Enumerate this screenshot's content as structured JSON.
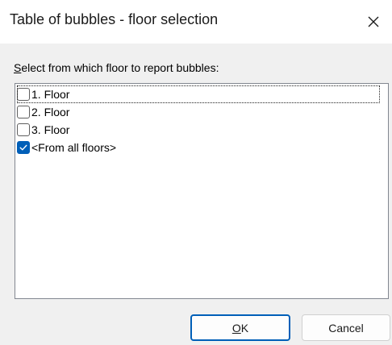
{
  "dialog": {
    "title": "Table of bubbles - floor selection",
    "close_icon": "close-icon"
  },
  "prompt": {
    "mnemonic": "S",
    "rest": "elect from which floor to report bubbles:"
  },
  "floors": {
    "items": [
      {
        "label": "1. Floor",
        "checked": false,
        "focused": true
      },
      {
        "label": "2. Floor",
        "checked": false,
        "focused": false
      },
      {
        "label": "3. Floor",
        "checked": false,
        "focused": false
      },
      {
        "label": "<From all floors>",
        "checked": true,
        "focused": false
      }
    ]
  },
  "buttons": {
    "ok_mnemonic": "O",
    "ok_rest": "K",
    "cancel": "Cancel"
  },
  "colors": {
    "accent": "#005fb8",
    "dialog_bg": "#f0f0f0",
    "titlebar_bg": "#ffffff"
  }
}
